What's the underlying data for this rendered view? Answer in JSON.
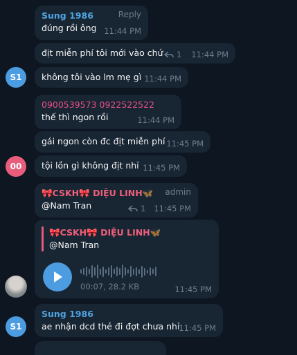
{
  "messages": [
    {
      "sender": "Sung 1986",
      "tag": "Reply",
      "text": "đúng rồi ông",
      "time": "11:44 PM"
    },
    {
      "text": "địt miễn phí tôi mới vào chứ",
      "replies": "1",
      "time": "11:44 PM"
    },
    {
      "avatar": "S1",
      "text": "không tôi vào lm mẹ gì",
      "time": "11:44 PM"
    },
    {
      "sender": "0900539573 0922522522",
      "text": "thế thì ngon rồi",
      "time": "11:44 PM"
    },
    {
      "text": "gái ngon còn đc địt miễn phí",
      "time": "11:45 PM"
    },
    {
      "avatar": "00",
      "text": "tội lồn gì không địt nhỉ",
      "time": "11:45 PM"
    },
    {
      "sender": "CSKH",
      "sender_suffix": "DIỆU LINH",
      "tag": "admin",
      "text": "@Nam Tran",
      "replies": "1",
      "time": "11:45 PM"
    },
    {
      "quote_sender": "CSKH",
      "quote_sender_suffix": "DIỆU LINH",
      "quote_text": "@Nam Tran",
      "audio_info": "00:07, 28.2 KB",
      "time": "11:45 PM"
    },
    {
      "avatar": "S1",
      "sender": "Sung 1986",
      "text": "ae nhận dcd thẻ đi đợt chưa nhỉ",
      "time": "11:45 PM"
    }
  ],
  "colors": {
    "background": "#0e1621",
    "bubble": "#182533",
    "sender_blue": "#4fa3e0",
    "sender_pink": "#e94f89",
    "avatar_blue": "#4c9ce2",
    "avatar_pink": "#e85d7b",
    "play": "#4c9ce2"
  }
}
